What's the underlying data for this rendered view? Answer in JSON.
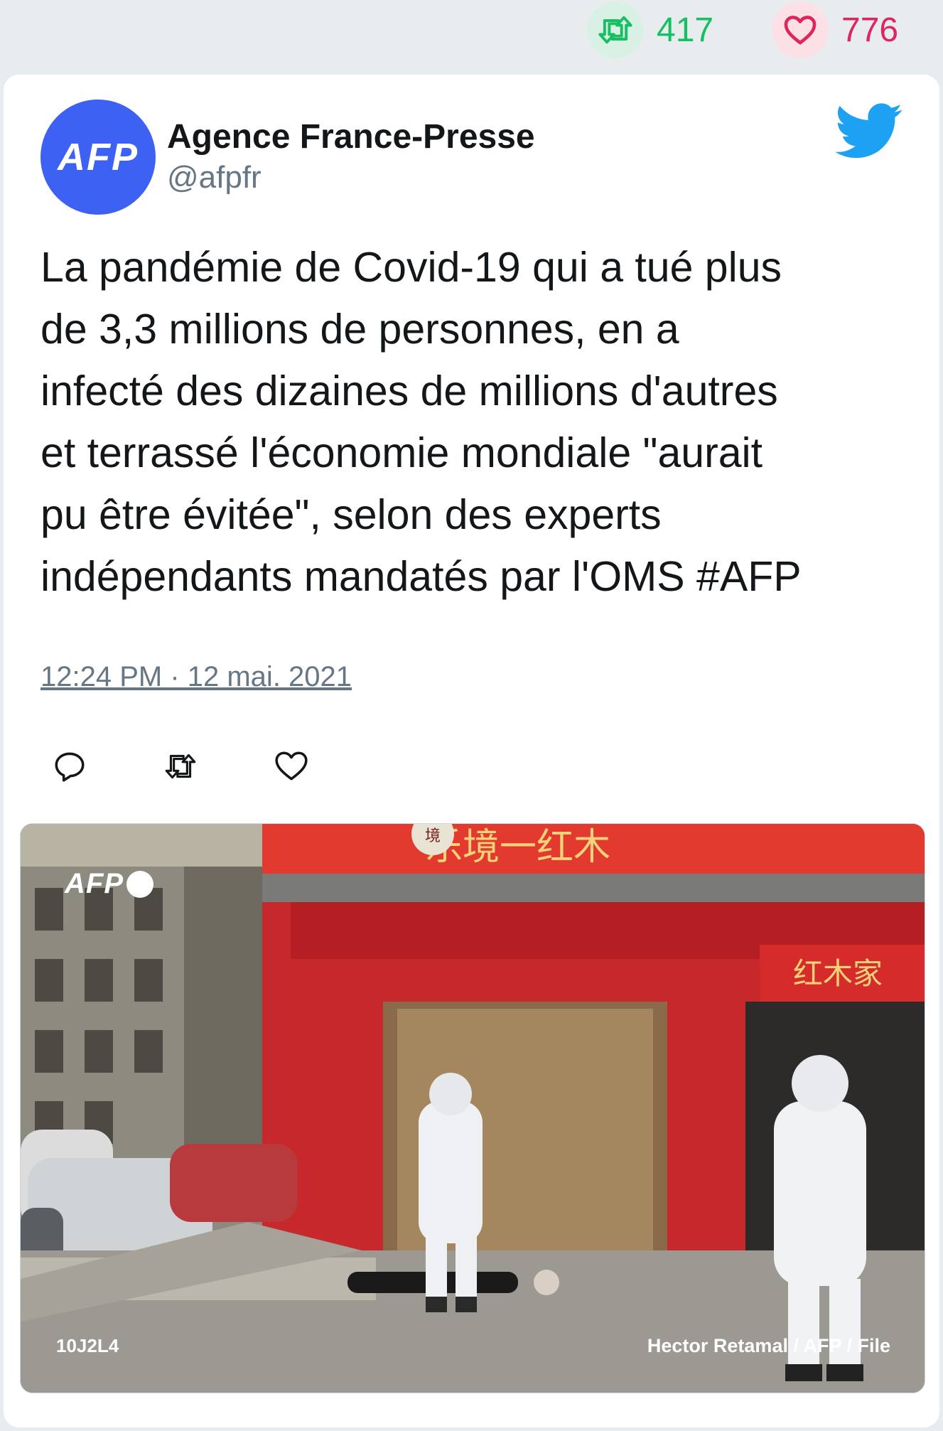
{
  "stats": {
    "retweets": "417",
    "likes": "776",
    "retweet_icon": "retweet-icon",
    "like_icon": "heart-icon",
    "retweet_color": "#17bf63",
    "like_color": "#e0245e"
  },
  "tweet": {
    "author_name": "Agence France-Presse",
    "handle": "@afpfr",
    "avatar_text": "AFP",
    "avatar_color": "#3d61f2",
    "text_lines": [
      "La pandémie de Covid-19 qui a tué plus",
      "de 3,3 millions de personnes, en a",
      "infecté des dizaines de millions d'autres",
      "et terrassé l'économie mondiale \"aurait",
      "pu être évitée\", selon des experts",
      "indépendants mandatés par l'OMS #AFP"
    ],
    "timestamp": "12:24 PM · 12 mai. 2021",
    "brand_icon": "twitter-bird-icon",
    "brand_color": "#1da1f2"
  },
  "actions": {
    "reply_icon": "reply-icon",
    "retweet_icon": "retweet-icon",
    "like_icon": "heart-icon"
  },
  "photo": {
    "watermark": "AFP",
    "photo_id": "10J2L4",
    "credit": "Hector Retamal / AFP / File",
    "sign_text_top": "乐境一红木",
    "sign_text_right": "红木家",
    "sign_text_small": "境"
  }
}
